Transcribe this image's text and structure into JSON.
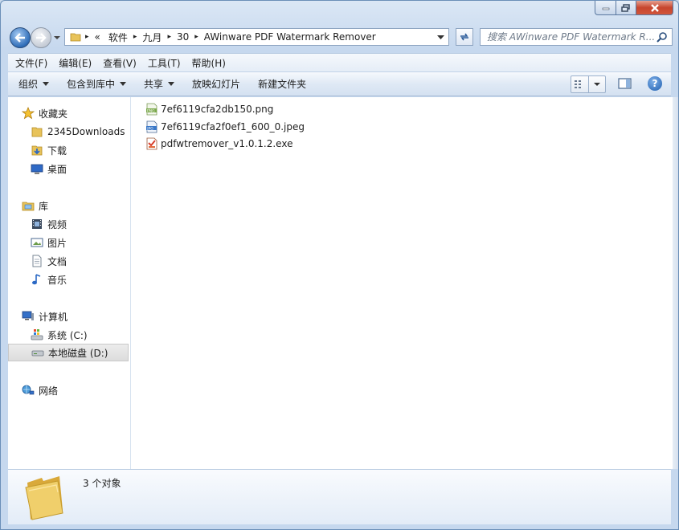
{
  "breadcrumb": {
    "overflow": "«",
    "items": [
      "软件",
      "九月",
      "30",
      "AWinware PDF Watermark Remover"
    ]
  },
  "search": {
    "placeholder": "搜索 AWinware PDF Watermark R..."
  },
  "menubar": {
    "items": [
      "文件(F)",
      "编辑(E)",
      "查看(V)",
      "工具(T)",
      "帮助(H)"
    ]
  },
  "commandbar": {
    "organize": "组织",
    "include_in_library": "包含到库中",
    "share": "共享",
    "slideshow": "放映幻灯片",
    "new_folder": "新建文件夹"
  },
  "navigation": {
    "favorites": {
      "label": "收藏夹",
      "items": [
        "2345Downloads",
        "下载",
        "桌面"
      ]
    },
    "libraries": {
      "label": "库",
      "items": [
        "视频",
        "图片",
        "文档",
        "音乐"
      ]
    },
    "computer": {
      "label": "计算机",
      "items": [
        "系统 (C:)",
        "本地磁盘 (D:)"
      ]
    },
    "network": {
      "label": "网络"
    }
  },
  "files": [
    {
      "name": "7ef6119cfa2db150.png",
      "icon": "png-file-icon"
    },
    {
      "name": "7ef6119cfa2f0ef1_600_0.jpeg",
      "icon": "jpeg-file-icon"
    },
    {
      "name": "pdfwtremover_v1.0.1.2.exe",
      "icon": "exe-file-icon"
    }
  ],
  "details": {
    "count": "3 个对象"
  },
  "colors": {
    "frame": "#c6d8ee",
    "selection": "#dcdcdc",
    "accent": "#2f6db8",
    "close": "#c7452e"
  }
}
